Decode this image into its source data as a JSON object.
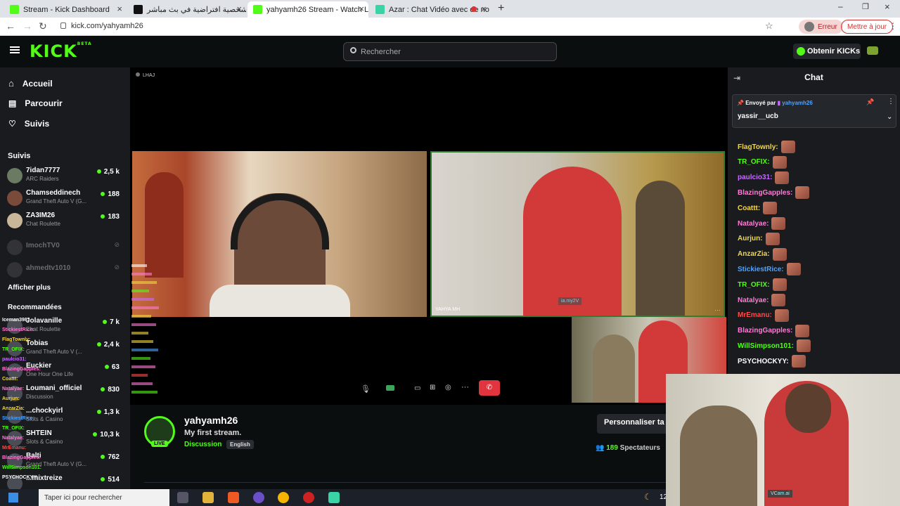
{
  "tabs": [
    {
      "title": "Stream - Kick Dashboard",
      "favicon_color": "#53fc18"
    },
    {
      "title": "شخصية افتراضية في بث مباشر | ...",
      "favicon_color": "#111111"
    },
    {
      "title": "yahyamh26 Stream - Watch Live",
      "favicon_color": "#53fc18"
    },
    {
      "title": "Azar : Chat Vidéo avec de no",
      "favicon_color": "#39d3a5"
    }
  ],
  "address": {
    "url": "kick.com/yahyamh26",
    "error_label": "Erreur",
    "update_label": "Mettre à jour"
  },
  "header": {
    "logo": "KICK",
    "logo_badge": "BETA",
    "search_placeholder": "Rechercher",
    "get_kicks_label": "Obtenir KICKs"
  },
  "sidebar": {
    "nav": [
      {
        "label": "Accueil",
        "icon": "home-icon"
      },
      {
        "label": "Parcourir",
        "icon": "browse-icon"
      },
      {
        "label": "Suivis",
        "icon": "heart-icon"
      }
    ],
    "following_title": "Suivis",
    "following": [
      {
        "name": "7idan7777",
        "category": "ARC Raiders",
        "viewers": "2,5 k"
      },
      {
        "name": "Chamseddinech",
        "category": "Grand Theft Auto V (G...",
        "viewers": "188"
      },
      {
        "name": "ZA3IM26",
        "category": "Chat Roulette",
        "viewers": "183"
      },
      {
        "name": "ImochTV0",
        "category": "",
        "viewers": ""
      },
      {
        "name": "ahmedtv1010",
        "category": "",
        "viewers": ""
      }
    ],
    "show_more": "Afficher plus",
    "recommended_title": "Recommandées",
    "recommended": [
      {
        "name": "Jolavanille",
        "category": "Chat Roulette",
        "viewers": "7 k"
      },
      {
        "name": "Tobias",
        "category": "Grand Theft Auto V (...",
        "viewers": "2,4 k"
      },
      {
        "name": "Euckier",
        "category": "One Hour One Life",
        "viewers": "63"
      },
      {
        "name": "Loumani_officiel",
        "category": "Discussion",
        "viewers": "830"
      },
      {
        "name": "...chockyirl",
        "category": "Slots & Casino",
        "viewers": "1,3 k"
      },
      {
        "name": "SHTEIN",
        "category": "Slots & Casino",
        "viewers": "10,3 k"
      },
      {
        "name": "Balti",
        "category": "Grand Theft Auto V (G...",
        "viewers": "762"
      },
      {
        "name": "...mixtreize",
        "category": "",
        "viewers": "514"
      }
    ],
    "overlay_names": [
      "Iceman398:",
      "StickiestRice:",
      "FlagTownly:",
      "TR_OFIX:",
      "paulcio31:",
      "BlazingGapples:",
      "Coattt:",
      "Natalyae:",
      "Aurjun:",
      "AnzarZia:",
      "StickiestRice:",
      "TR_OFIX:",
      "Natalyae:",
      "MrEmanu:",
      "BlazingGapples:",
      "WillSimpson101:",
      "PSYCHOCKYY:"
    ]
  },
  "player": {
    "top_label": "LHAJ",
    "tile_label_2": "YAHYA MH",
    "watermark": "ia.my2V"
  },
  "stream_info": {
    "streamer": "yahyamh26",
    "title": "My first stream.",
    "category": "Discussion",
    "language": "English",
    "live_badge": "LIVE",
    "customize_label": "Personnaliser ta",
    "viewers": "189",
    "viewers_label": "Spectateurs"
  },
  "chat": {
    "title": "Chat",
    "pinned_prefix": "Envoyé par",
    "pinned_user": "yahyamh26",
    "pinned_message": "yassir__ucb",
    "messages": [
      {
        "user": "FlagTownly:",
        "color": "#f5d742"
      },
      {
        "user": "TR_OFIX:",
        "color": "#53fc18"
      },
      {
        "user": "paulcio31:",
        "color": "#c86bff"
      },
      {
        "user": "BlazingGapples:",
        "color": "#ff7bd5"
      },
      {
        "user": "Coattt:",
        "color": "#f5d742"
      },
      {
        "user": "Natalyae:",
        "color": "#ff7bd5"
      },
      {
        "user": "Aurjun:",
        "color": "#f5d742"
      },
      {
        "user": "AnzarZia:",
        "color": "#f5d742"
      },
      {
        "user": "StickiestRice:",
        "color": "#4ea3ff"
      },
      {
        "user": "TR_OFIX:",
        "color": "#53fc18"
      },
      {
        "user": "Natalyae:",
        "color": "#ff7bd5"
      },
      {
        "user": "MrEmanu:",
        "color": "#ff4a4a"
      },
      {
        "user": "BlazingGapples:",
        "color": "#ff7bd5"
      },
      {
        "user": "WillSimpson101:",
        "color": "#53fc18"
      },
      {
        "user": "PSYCHOCKYY:",
        "color": "#ffffff"
      }
    ]
  },
  "taskbar": {
    "search_placeholder": "Taper ici pour rechercher",
    "clock": "12",
    "webcam_label": "VCam.ai"
  },
  "colors": {
    "kick_green": "#53fc18",
    "bg": "#0b0e0f",
    "panel": "#191b1f",
    "end_call": "#e2343f"
  }
}
